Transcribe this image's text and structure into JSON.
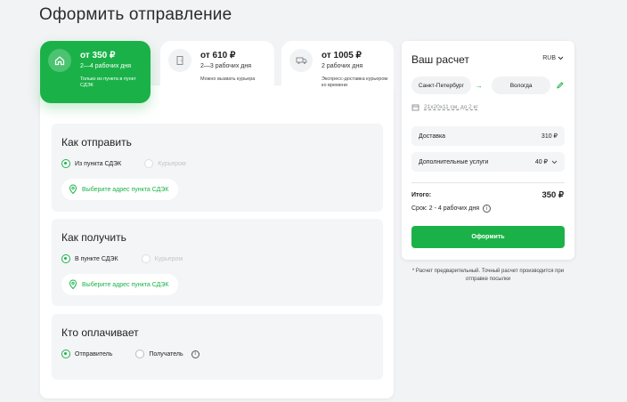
{
  "page": {
    "title": "Оформить отправление"
  },
  "tabs": [
    {
      "price": "от 350 ₽",
      "days": "2—4 рабочих дня",
      "note": "Только из пункта в пункт СДЭК",
      "icon": "home-icon",
      "active": true
    },
    {
      "price": "от 610 ₽",
      "days": "2—3 рабочих дня",
      "note": "Можно вызвать курьера",
      "icon": "door-icon",
      "active": false
    },
    {
      "price": "от 1005 ₽",
      "days": "2 рабочих дня",
      "note": "Экспресс-доставка курьером ко времени",
      "icon": "truck-icon",
      "active": false
    }
  ],
  "sections": {
    "send": {
      "title": "Как отправить",
      "options": [
        {
          "label": "Из пункта СДЭК",
          "checked": true,
          "disabled": false
        },
        {
          "label": "Курьером",
          "checked": false,
          "disabled": true
        }
      ],
      "address_button": "Выберите адрес пункта СДЭК"
    },
    "receive": {
      "title": "Как получить",
      "options": [
        {
          "label": "В пункте СДЭК",
          "checked": true,
          "disabled": false
        },
        {
          "label": "Курьером",
          "checked": false,
          "disabled": true
        }
      ],
      "address_button": "Выберите адрес пункта СДЭК"
    },
    "payer": {
      "title": "Кто оплачивает",
      "options": [
        {
          "label": "Отправитель",
          "checked": true,
          "disabled": false
        },
        {
          "label": "Получатель",
          "checked": false,
          "disabled": false
        }
      ]
    }
  },
  "summary": {
    "title": "Ваш расчет",
    "currency": "RUB",
    "from_city": "Санкт-Петербург",
    "to_city": "Вологда",
    "package_size": "21х20х11 см, до 2 кг",
    "delivery_label": "Доставка",
    "delivery_amount": "310 ₽",
    "extra_label": "Дополнительные услуги",
    "extra_amount": "40 ₽",
    "total_label": "Итого:",
    "total_value": "350 ₽",
    "term": "Срок: 2 - 4 рабочих дня",
    "order_button": "Оформить"
  },
  "disclaimer": "* Расчет предварительный. Точный расчет производится при отправке посылки",
  "colors": {
    "accent": "#1ab248",
    "background": "#f2f3f5"
  }
}
